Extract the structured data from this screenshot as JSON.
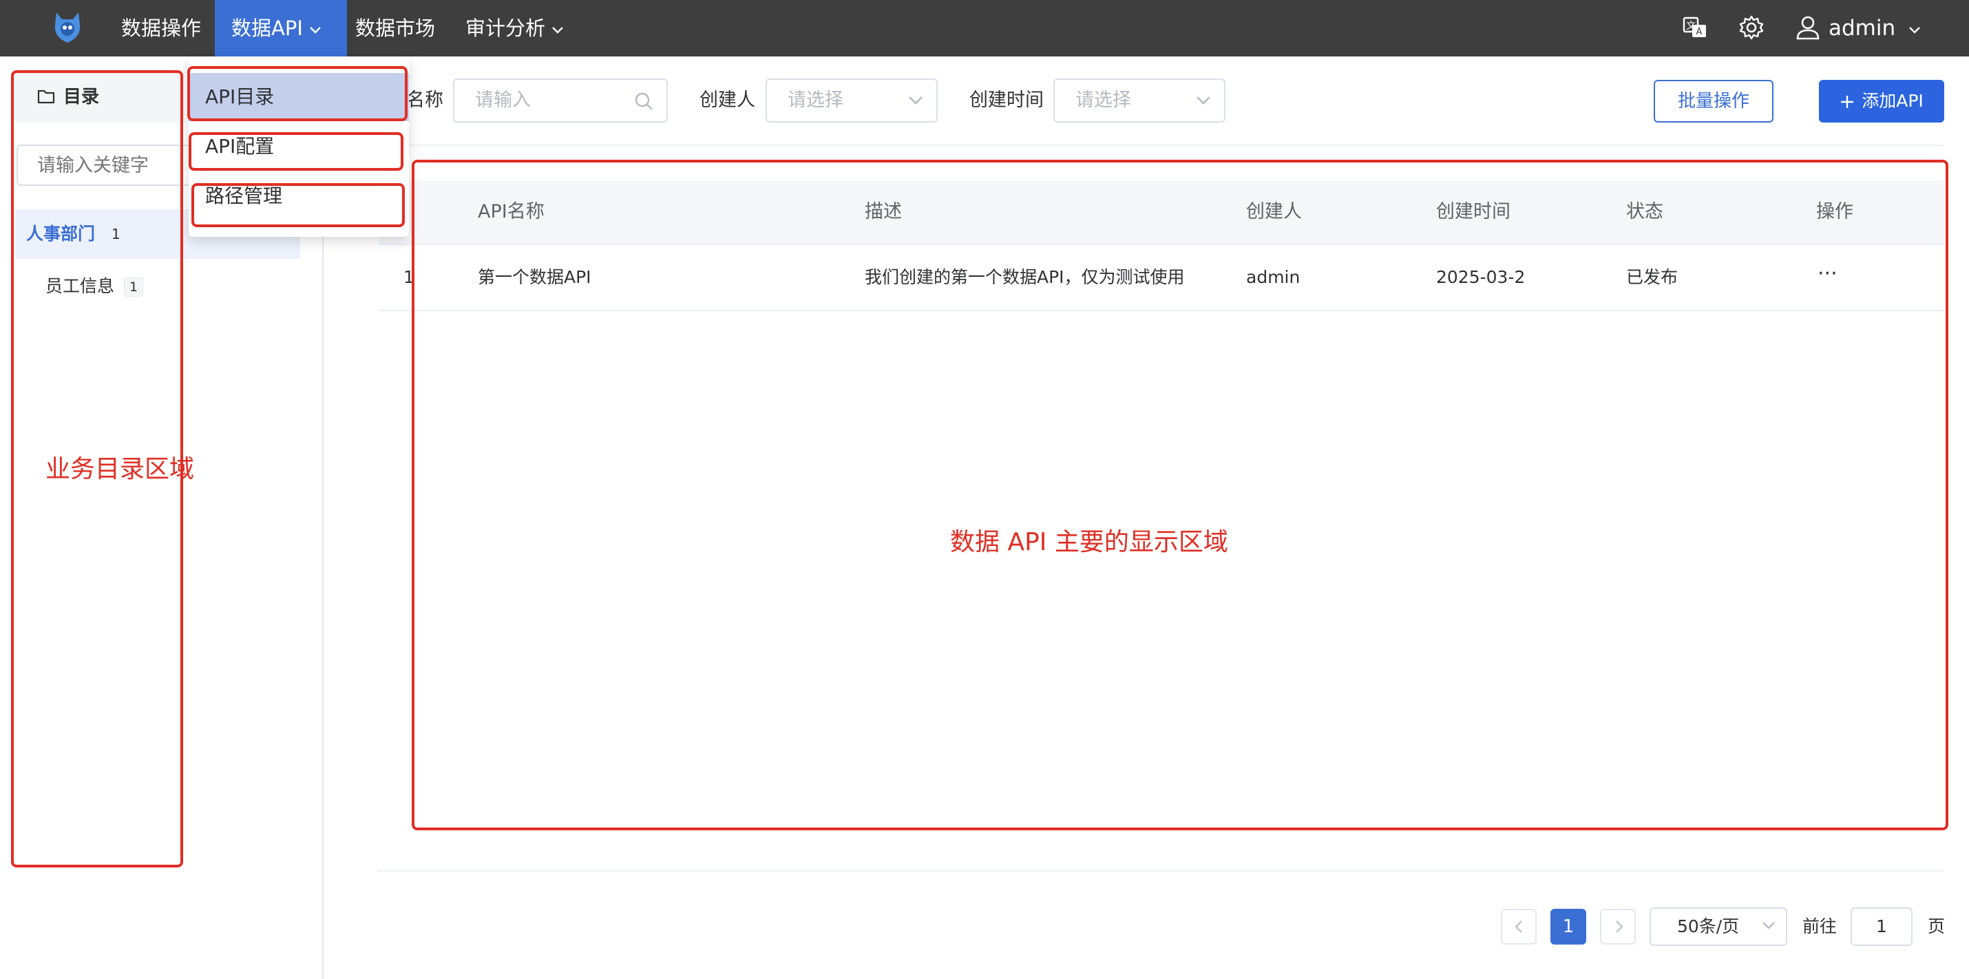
{
  "topbar": {
    "nav": [
      {
        "label": "数据操作",
        "has_dropdown": false
      },
      {
        "label": "数据API",
        "has_dropdown": true,
        "active": true
      },
      {
        "label": "数据市场",
        "has_dropdown": false
      },
      {
        "label": "审计分析",
        "has_dropdown": true
      }
    ],
    "icons": [
      "translate-icon",
      "gear-icon",
      "user-icon"
    ],
    "user": "admin"
  },
  "dropdown": {
    "items": [
      "API目录",
      "API配置",
      "路径管理"
    ],
    "active_index": 0
  },
  "sidebar": {
    "header": "目录",
    "search_placeholder": "请输入关键字",
    "tree": [
      {
        "label": "人事部门",
        "count": "1",
        "selected": true
      },
      {
        "label": "员工信息",
        "count": "1",
        "selected": false
      }
    ]
  },
  "filters": {
    "name_label": "名称",
    "name_placeholder": "请输入",
    "creator_label": "创建人",
    "creator_placeholder": "请选择",
    "time_label": "创建时间",
    "time_placeholder": "请选择",
    "batch_button": "批量操作",
    "add_button": "添加API"
  },
  "table": {
    "columns": [
      "API名称",
      "描述",
      "创建人",
      "创建时间",
      "状态",
      "操作"
    ],
    "rows": [
      {
        "index": "1",
        "name": "第一个数据API",
        "description": "我们创建的第一个数据API，仅为测试使用",
        "creator": "admin",
        "created": "2025-03-2",
        "status": "已发布",
        "actions": "···"
      }
    ]
  },
  "pagination": {
    "current": "1",
    "page_size": "50条/页",
    "goto_label": "前往",
    "goto_value": "1",
    "page_suffix": "页"
  },
  "annotations": {
    "sidebar_area": "业务目录区域",
    "main_area": "数据 API 主要的显示区域"
  },
  "colors": {
    "topbar_bg": "#3e3e3e",
    "accent": "#3b6fd4",
    "primary_button": "#2b64de",
    "annotation_red": "#e02e24"
  }
}
